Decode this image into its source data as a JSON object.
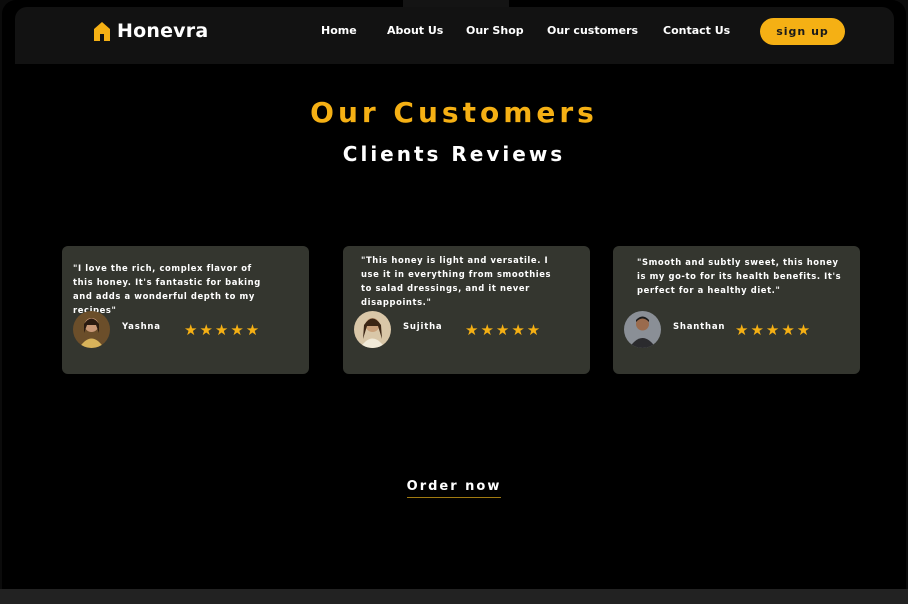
{
  "nav": {
    "brand": "Honevra",
    "links": [
      "Home",
      "About Us",
      "Our Shop",
      "Our customers",
      "Contact Us"
    ],
    "signup_label": "sign up"
  },
  "section": {
    "title": "Our Customers",
    "subtitle": "Clients Reviews"
  },
  "reviews": [
    {
      "quote": "\"I love the rich, complex flavor of this honey. It's fantastic for baking and adds a wonderful depth to my recipes\"",
      "name": "Yashna",
      "rating": 5,
      "stars": "★★★★★"
    },
    {
      "quote": "\"This honey is light and versatile. I use it in everything from smoothies to salad dressings, and it never disappoints.\"",
      "name": "Sujitha",
      "rating": 5,
      "stars": "★★★★★"
    },
    {
      "quote": "\"Smooth and subtly sweet, this honey is my go-to for its health benefits. It's perfect for a healthy diet.\"",
      "name": "Shanthan",
      "rating": 5,
      "stars": "★★★★★"
    }
  ],
  "cta": {
    "order_label": "Order now"
  },
  "colors": {
    "accent": "#f5b014",
    "background": "#000000",
    "card": "#34362f",
    "navbar": "#121212"
  },
  "icons": {
    "brand": "house-icon",
    "rating": "star-icon"
  }
}
